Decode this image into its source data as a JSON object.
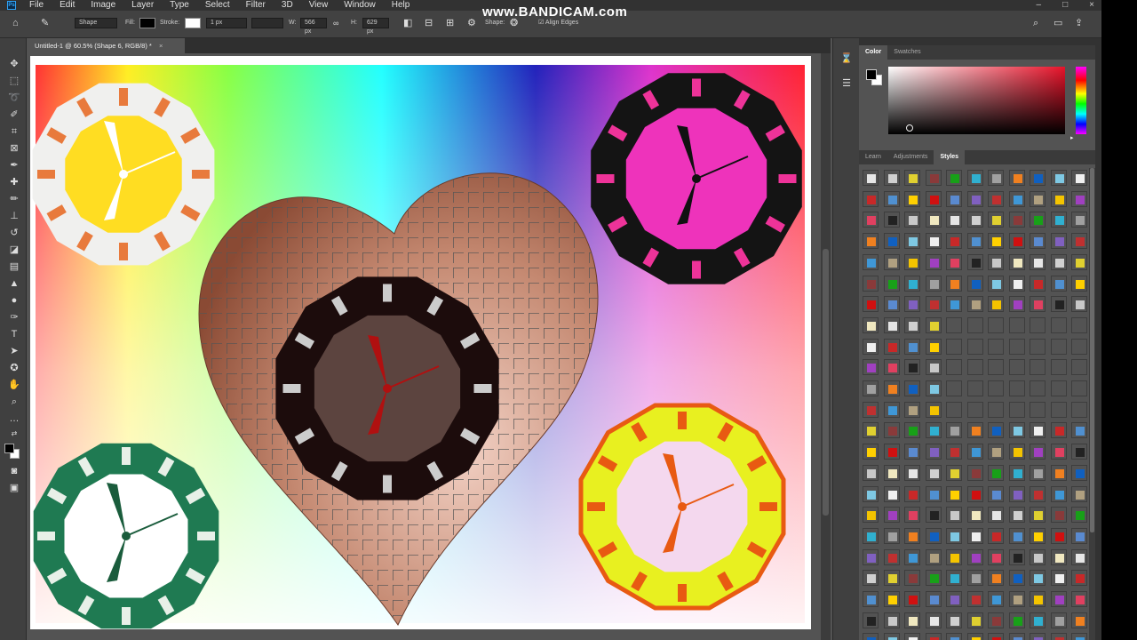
{
  "app": {
    "logo": "Ps",
    "menu": [
      "File",
      "Edit",
      "Image",
      "Layer",
      "Type",
      "Select",
      "Filter",
      "3D",
      "View",
      "Window",
      "Help"
    ],
    "window_controls": [
      "–",
      "□",
      "×"
    ]
  },
  "watermark": "www.BANDICAM.com",
  "options": {
    "mode": "Shape",
    "fill_label": "Fill:",
    "stroke_label": "Stroke:",
    "stroke_width": "1 px",
    "w_label": "W:",
    "w_value": "566 px",
    "h_label": "H:",
    "h_value": "629 px",
    "shape_label": "Shape:",
    "align_edges": "Align Edges"
  },
  "document": {
    "tab_title": "Untitled-1 @ 60.5% (Shape 6, RGB/8) *",
    "close": "×"
  },
  "tools": [
    "move-tool",
    "marquee-tool",
    "lasso-tool",
    "quick-select-tool",
    "crop-tool",
    "frame-tool",
    "eyedropper-tool",
    "healing-tool",
    "brush-tool",
    "stamp-tool",
    "history-brush-tool",
    "eraser-tool",
    "gradient-tool",
    "blur-tool",
    "dodge-tool",
    "pen-tool",
    "type-tool",
    "path-select-tool",
    "custom-shape-tool",
    "hand-tool",
    "zoom-tool",
    "more-tools"
  ],
  "color_panel": {
    "tabs": [
      "Color",
      "Swatches"
    ],
    "fg": "#000000",
    "bg": "#ffffff",
    "hue": "#e8132a"
  },
  "styles_panel": {
    "tabs": [
      "Learn",
      "Adjustments",
      "Styles"
    ]
  },
  "artwork": {
    "clocks": [
      {
        "name": "white-clock",
        "ring": "#f0f0ee",
        "face": "#ffdd22",
        "marks": "#e87a3c",
        "hands": "#ffffff"
      },
      {
        "name": "black-clock",
        "ring": "#141414",
        "face": "#ee33bb",
        "marks": "#ee3399",
        "hands": "#111111"
      },
      {
        "name": "green-clock",
        "ring": "#1f7a52",
        "face": "#ffffff",
        "marks": "#e8f0e8",
        "hands": "#1a5c3c"
      },
      {
        "name": "yellow-clock",
        "ring": "#e8f020",
        "face": "#f4d8ee",
        "marks": "#e85a12",
        "hands": "#e85a12"
      },
      {
        "name": "center-clock",
        "ring": "#1c0c0c",
        "face": "#d4b0a0",
        "marks": "#cccccc",
        "hands": "#b01010"
      }
    ],
    "heart_color": "#9a5a44"
  },
  "style_swatch_colors": [
    "#e6e6e6",
    "#7ec8e3",
    "#3f97d6",
    "#d0d0d0",
    "#f0f0f0",
    "#b0a080",
    "#e0d030",
    "#c82828",
    "#f4c400",
    "#8a3a3a",
    "#5090d0",
    "#a040c0",
    "#18a018",
    "#ffd000",
    "#e04060",
    "#30b0d0",
    "#d01010",
    "#222222",
    "#a0a0a0",
    "#5a8ad0",
    "#c8c8c8",
    "#f08020",
    "#8060c0",
    "#f0e8c0",
    "#1060c0",
    "#c03030"
  ]
}
